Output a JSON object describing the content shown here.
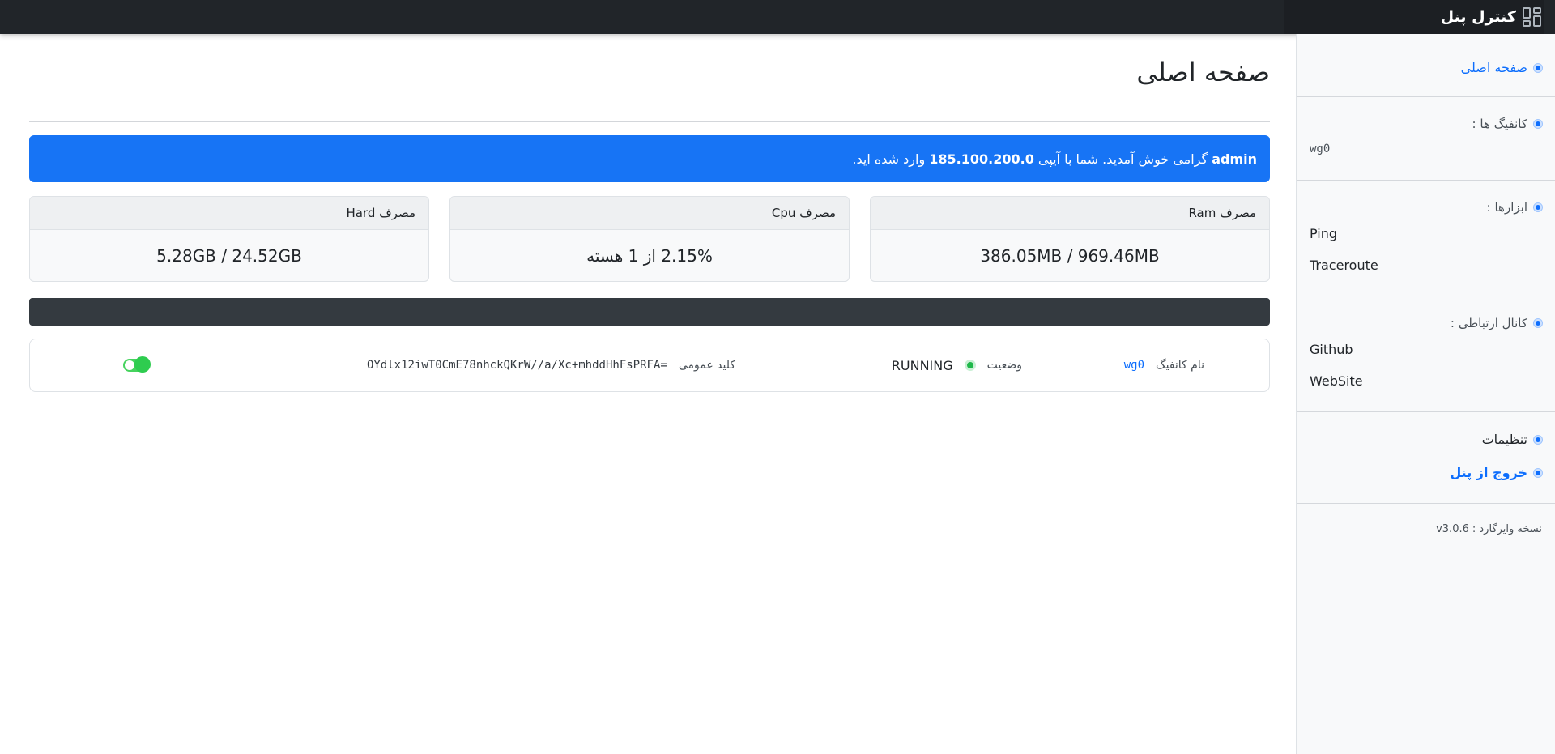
{
  "app": {
    "title": "کنترل پنل"
  },
  "sidebar": {
    "home": "صفحه اصلی",
    "configs_heading": "کانفیگ ها :",
    "configs": [
      "wg0"
    ],
    "tools_heading": "ابزارها :",
    "tools": [
      "Ping",
      "Traceroute"
    ],
    "contact_heading": "کانال ارتباطی :",
    "contact": [
      "Github",
      "WebSite"
    ],
    "settings": "تنظیمات",
    "logout": "خروج از پنل",
    "version_label": "نسخه وایرگارد :",
    "version": "v3.0.6"
  },
  "main": {
    "title": "صفحه اصلی",
    "alert": {
      "user": "admin",
      "text1": " گرامی خوش آمدید. شما با آیپی ",
      "ip": "185.100.200.0",
      "text2": " وارد شده اید."
    },
    "cards": [
      {
        "label": "مصرف Ram",
        "value": "386.05MB / 969.46MB"
      },
      {
        "label": "مصرف Cpu",
        "value": "2.15% از 1 هسته"
      },
      {
        "label": "مصرف Hard",
        "value": "5.28GB / 24.52GB"
      }
    ],
    "config_row": {
      "name_label": "نام کانفیگ",
      "name": "wg0",
      "status_label": "وضعیت",
      "status": "RUNNING",
      "key_label": "کلید عمومی",
      "key": "OYdlx12iwT0CmE78nhckQKrW//a/Xc+mhddHhFsPRFA="
    }
  },
  "colors": {
    "accent": "#0d6efd",
    "topbar": "#212529",
    "alert": "#1774f5",
    "running": "#1fb84a"
  }
}
